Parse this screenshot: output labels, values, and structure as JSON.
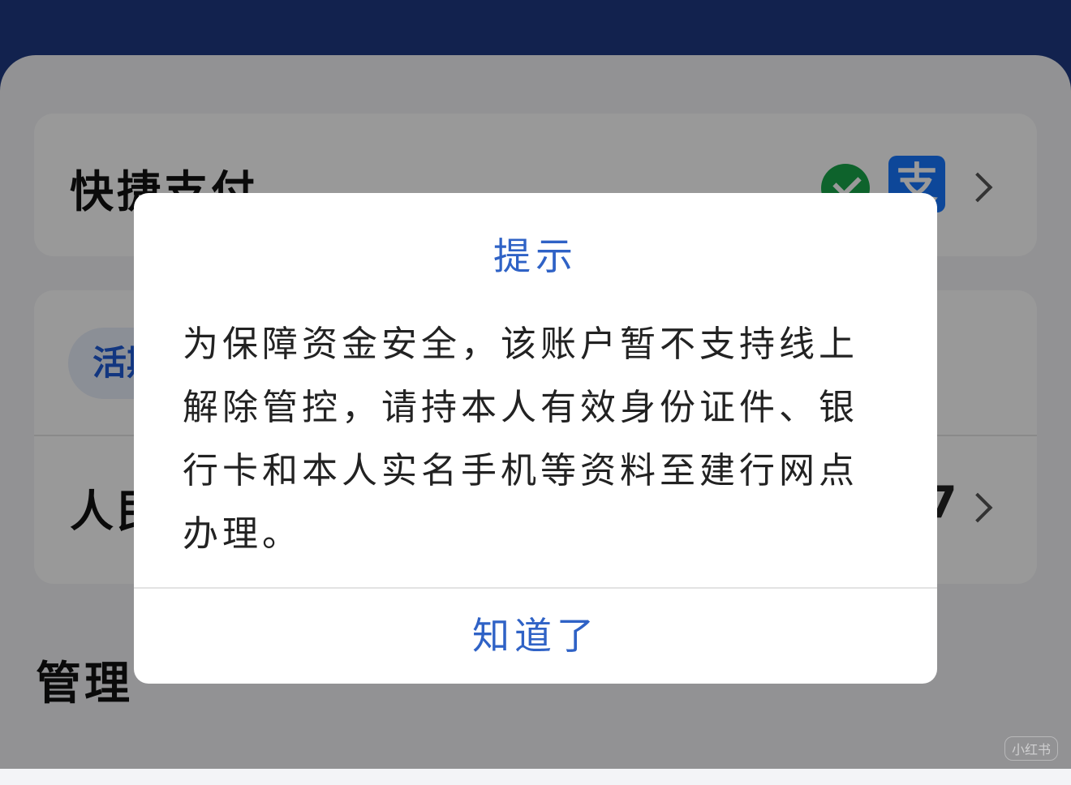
{
  "header": {
    "background_color": "#1e3a82"
  },
  "quick_pay": {
    "title": "快捷支付",
    "wechat_color": "#18a64a",
    "alipay_glyph": "支",
    "alipay_color": "#1677ff"
  },
  "accounts_card": {
    "tag_label": "活期",
    "row_title": "人民币",
    "trailing": "7"
  },
  "section": {
    "title": "管理"
  },
  "dialog": {
    "title": "提示",
    "message": "为保障资金安全，该账户暂不支持线上解除管控，请持本人有效身份证件、银行卡和本人实名手机等资料至建行网点办理。",
    "confirm_label": "知道了",
    "accent_color": "#2f62c6"
  },
  "watermark": {
    "text": "小红书"
  }
}
